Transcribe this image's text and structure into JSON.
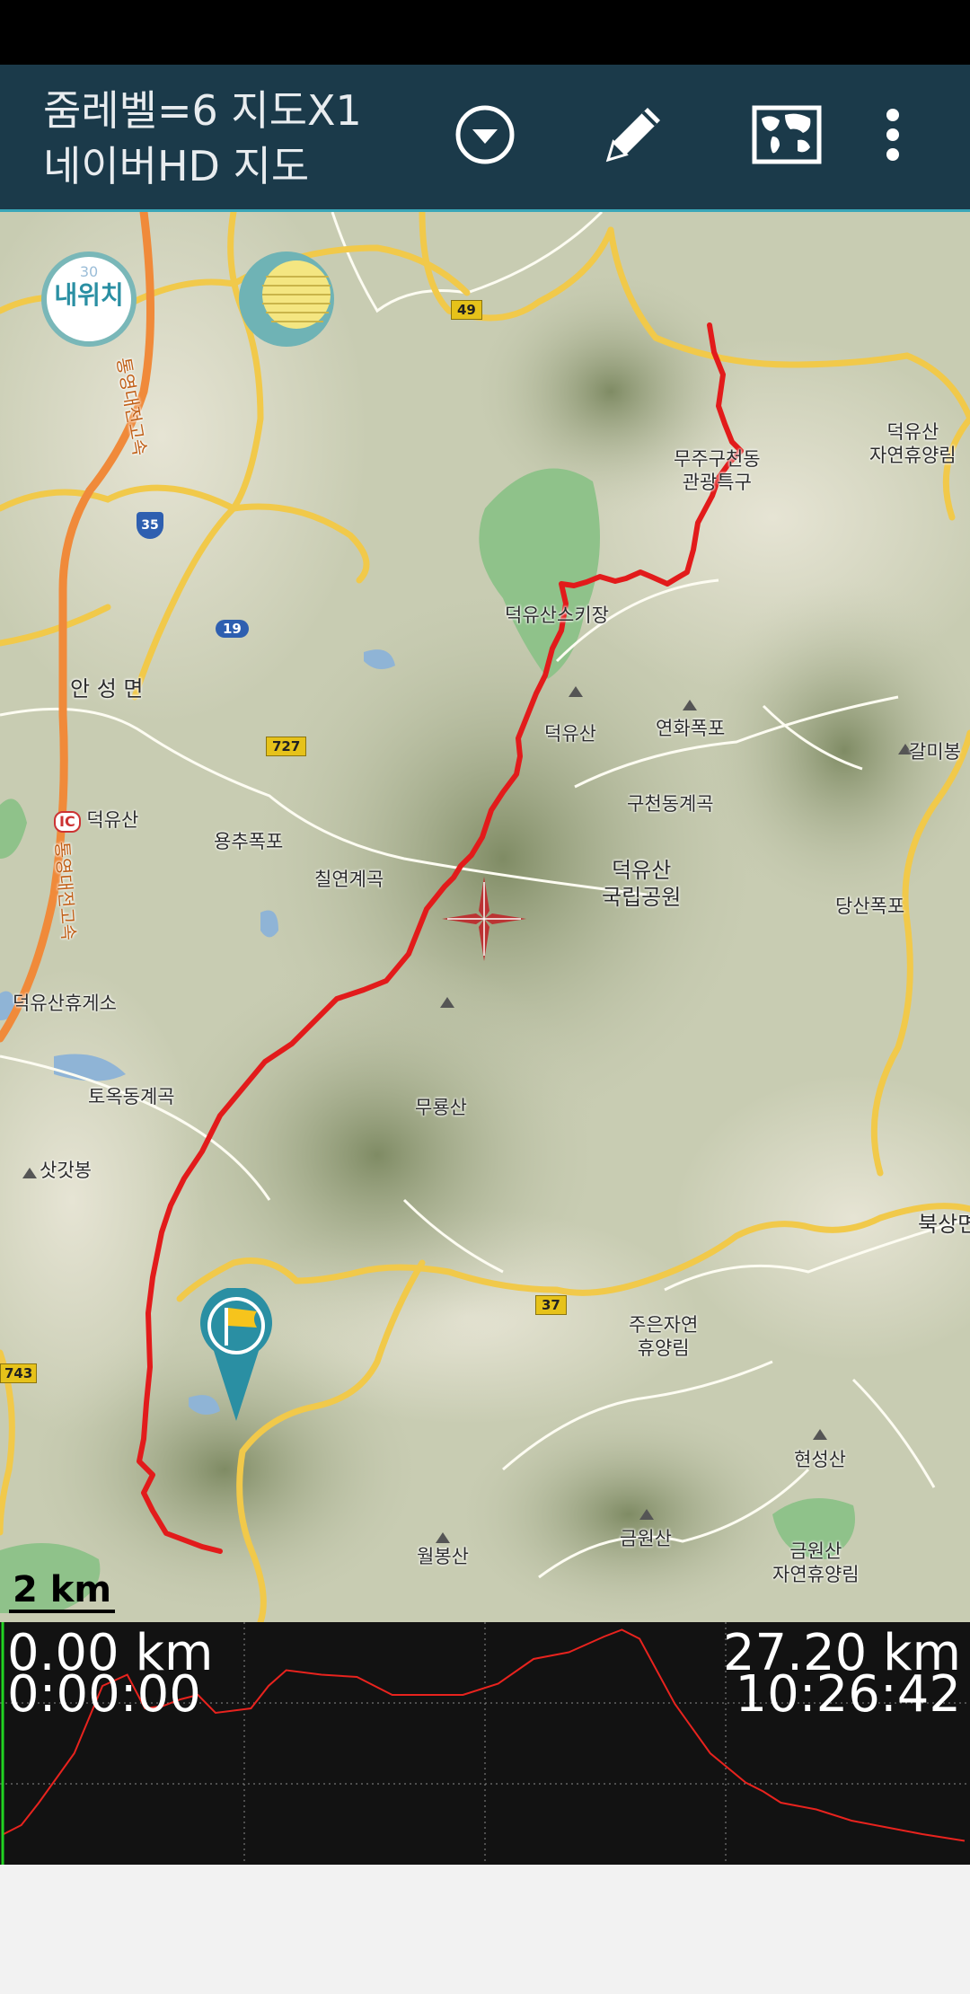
{
  "app_bar": {
    "title_line1": "줌레벨=6 지도X1",
    "title_line2": "네이버HD 지도",
    "icons": [
      "dropdown-circle-icon",
      "pencil-icon",
      "world-map-icon",
      "more-vert-icon"
    ]
  },
  "map": {
    "my_location_label": "내위치",
    "my_location_accuracy": "30",
    "scale_label": "2 km",
    "labels": {
      "mujuguchundong": "무주구천동\n관광특구",
      "deogyusan_forest": "덕유산\n자연휴양림",
      "ski": "덕유산스키장",
      "anseong": "안 성 면",
      "deogyusan_peak": "덕유산",
      "yeonhwa": "연화폭포",
      "galmi": "갈미봉",
      "gucheon": "구천동계곡",
      "ic_deogyusan": "덕유산",
      "yongchu": "용추폭포",
      "chilyeon": "칠연계곡",
      "park": "덕유산\n국립공원",
      "dangsan": "당산폭포",
      "rest_area": "덕유산휴게소",
      "tookdong": "토옥동계곡",
      "mubongsan": "무룡산",
      "satgatbong": "삿갓봉",
      "buksang": "북상면",
      "jueun": "주은자연\n휴양림",
      "hyeonseong": "현성산",
      "geumwon": "금원산",
      "geumwon_forest": "금원산\n자연휴양림",
      "wolbong": "월봉산",
      "expressway_top": "통영대전고속",
      "expressway_mid": "통영대전고속"
    },
    "road_numbers": [
      "49",
      "35",
      "19",
      "727",
      "37",
      "743"
    ],
    "ic_badge": "IC"
  },
  "elevation_chart": {
    "start_distance": "0.00 km",
    "start_time": "0:00:00",
    "end_distance": "27.20 km",
    "end_time": "10:26:42"
  },
  "chart_data": {
    "type": "line",
    "x": [
      0,
      0.5,
      1,
      2,
      2.8,
      3.5,
      4,
      4.5,
      5,
      5.5,
      6,
      7,
      7.5,
      8,
      9,
      10,
      11,
      12,
      13,
      14,
      15,
      16,
      17,
      17.5,
      18,
      19,
      20,
      21,
      21.5,
      22,
      23,
      24,
      25,
      26,
      27.2
    ],
    "values": [
      420,
      460,
      560,
      780,
      1080,
      1130,
      980,
      990,
      1020,
      1040,
      960,
      980,
      1080,
      1150,
      1130,
      1120,
      1040,
      1040,
      1040,
      1090,
      1200,
      1230,
      1300,
      1330,
      1290,
      1000,
      780,
      650,
      610,
      560,
      530,
      480,
      450,
      420,
      390
    ],
    "xlim": [
      0,
      27.2
    ],
    "ylim": [
      300,
      1340
    ],
    "series": [
      {
        "values_ref": "values"
      }
    ],
    "grid": true,
    "line_color": "#e8231e",
    "cursor_color": "#21d321"
  },
  "colors": {
    "app_bar": "#1b3a4a",
    "track": "#e21b1b",
    "chart_bg": "#121212"
  }
}
